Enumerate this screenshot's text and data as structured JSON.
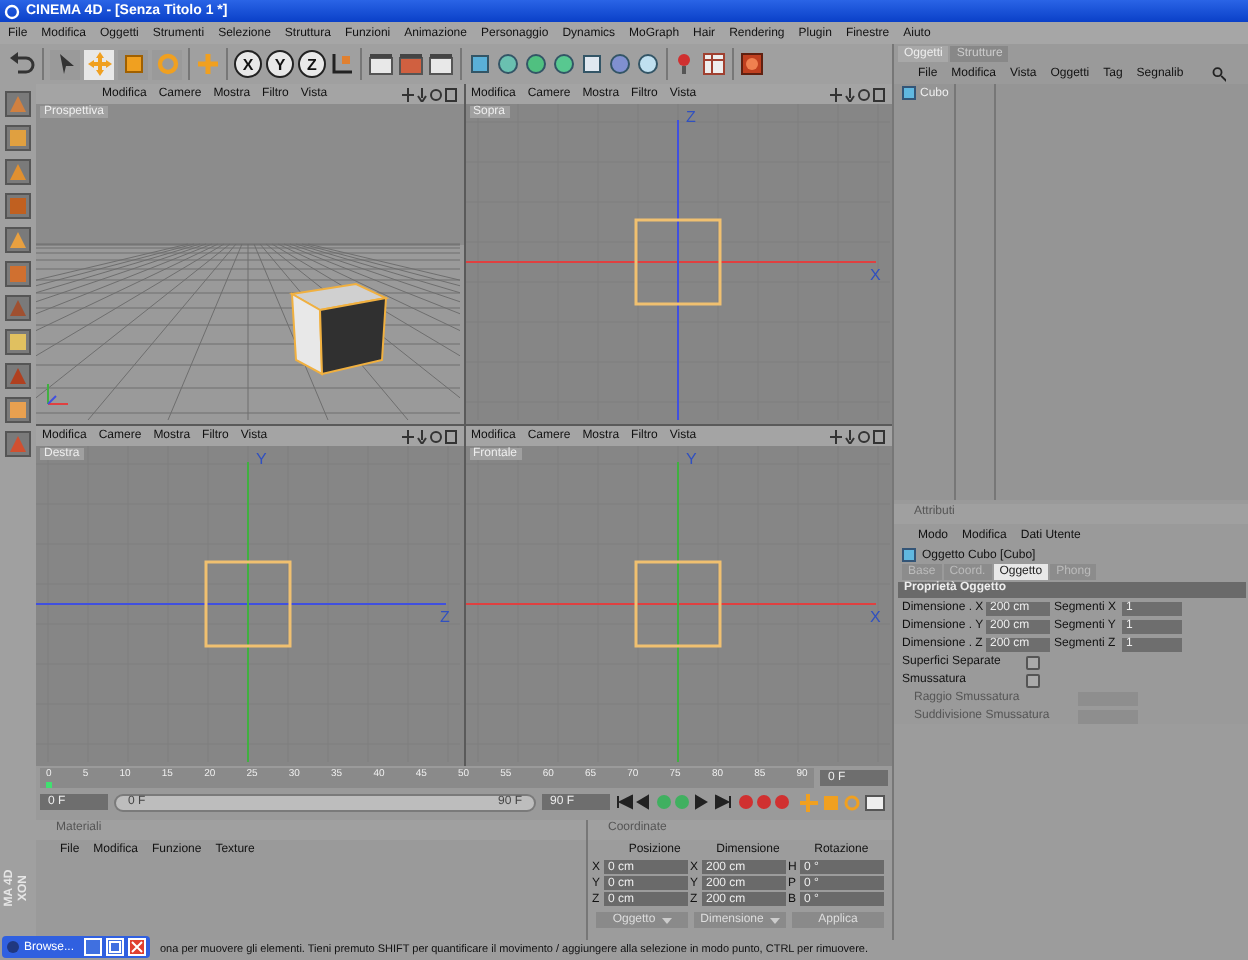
{
  "window": {
    "title": "CINEMA 4D - [Senza Titolo 1 *]"
  },
  "menu_bar": [
    "File",
    "Modifica",
    "Oggetti",
    "Strumenti",
    "Selezione",
    "Struttura",
    "Funzioni",
    "Animazione",
    "Personaggio",
    "Dynamics",
    "MoGraph",
    "Hair",
    "Rendering",
    "Plugin",
    "Finestre",
    "Aiuto"
  ],
  "toolbar": {
    "tools": [
      {
        "selected": false
      },
      {
        "selected": true
      },
      {
        "selected": false
      },
      {
        "selected": false
      }
    ],
    "axis_buttons": [
      {
        "label": "X",
        "on": true
      },
      {
        "label": "Y",
        "on": true
      },
      {
        "label": "Z",
        "on": true
      }
    ]
  },
  "viewports": [
    {
      "kind": "perspective",
      "label": "Prospettiva",
      "menu": [
        "Modifica",
        "Camere",
        "Mostra",
        "Filtro",
        "Vista"
      ]
    },
    {
      "kind": "top",
      "label": "Sopra",
      "menu": [
        "Modifica",
        "Camere",
        "Mostra",
        "Filtro",
        "Vista"
      ],
      "h_axis": "X",
      "v_axis": "Z"
    },
    {
      "kind": "right",
      "label": "Destra",
      "menu": [
        "Modifica",
        "Camere",
        "Mostra",
        "Filtro",
        "Vista"
      ],
      "h_axis": "Z",
      "v_axis": "Y"
    },
    {
      "kind": "front",
      "label": "Frontale",
      "menu": [
        "Modifica",
        "Camere",
        "Mostra",
        "Filtro",
        "Vista"
      ],
      "h_axis": "X",
      "v_axis": "Y"
    }
  ],
  "timeline": {
    "ticks": [
      "0",
      "5",
      "10",
      "15",
      "20",
      "25",
      "30",
      "35",
      "40",
      "45",
      "50",
      "55",
      "60",
      "65",
      "70",
      "75",
      "80",
      "85",
      "90"
    ],
    "level": 0,
    "current_frame": "0 F",
    "start": "0 F",
    "range": {
      "start": "0 F",
      "end": "90 F",
      "level": 1
    },
    "end": "90 F"
  },
  "materials": {
    "title": "Materiali",
    "menu": [
      "File",
      "Modifica",
      "Funzione",
      "Texture"
    ]
  },
  "coordinates": {
    "title": "Coordinate",
    "columns": [
      "Posizione",
      "Dimensione",
      "Rotazione"
    ],
    "rows": [
      {
        "axis": "X",
        "position": "0 cm",
        "size_axis": "X",
        "size": "200 cm",
        "rot_axis": "H",
        "rotation": "0 °"
      },
      {
        "axis": "Y",
        "position": "0 cm",
        "size_axis": "Y",
        "size": "200 cm",
        "rot_axis": "P",
        "rotation": "0 °"
      },
      {
        "axis": "Z",
        "position": "0 cm",
        "size_axis": "Z",
        "size": "200 cm",
        "rot_axis": "B",
        "rotation": "0 °"
      }
    ],
    "mode_dropdown": "Oggetto",
    "size_dropdown": "Dimensione",
    "apply_button": "Applica"
  },
  "objects": {
    "tabs": [
      {
        "label": "Oggetti",
        "selected": true
      },
      {
        "label": "Strutture",
        "selected": false
      }
    ],
    "menu": [
      "File",
      "Modifica",
      "Vista",
      "Oggetti",
      "Tag",
      "Segnalib"
    ],
    "items": [
      {
        "name": "Cubo",
        "selected": false
      }
    ]
  },
  "attributes": {
    "title": "Attributi",
    "menu": [
      "Modo",
      "Modifica",
      "Dati Utente"
    ],
    "object_title": "Oggetto Cubo [Cubo]",
    "tabs": [
      {
        "label": "Base",
        "selected": false
      },
      {
        "label": "Coord.",
        "selected": false
      },
      {
        "label": "Oggetto",
        "selected": true
      },
      {
        "label": "Phong",
        "selected": false
      }
    ],
    "section": "Proprietà Oggetto",
    "dimension_rows": [
      {
        "label": "Dimensione . X",
        "value": "200 cm",
        "seg_label": "Segmenti X",
        "seg_value": "1"
      },
      {
        "label": "Dimensione . Y",
        "value": "200 cm",
        "seg_label": "Segmenti Y",
        "seg_value": "1"
      },
      {
        "label": "Dimensione . Z",
        "value": "200 cm",
        "seg_label": "Segmenti Z",
        "seg_value": "1"
      }
    ],
    "checks": [
      {
        "label": "Superfici Separate",
        "checked": false
      },
      {
        "label": "Smussatura",
        "checked": false
      }
    ],
    "disabled_rows": [
      {
        "label": "Raggio Smussatura",
        "disabled": true
      },
      {
        "label": "Suddivisione Smussatura",
        "disabled": true
      }
    ]
  },
  "brand_lines": [
    "XON",
    "MA 4D"
  ],
  "taskbar_button": "Browse...",
  "status_bar": "ona per muovere gli elementi. Tieni premuto SHIFT per quantificare il movimento / aggiungere alla selezione in modo punto, CTRL per rimuovere."
}
